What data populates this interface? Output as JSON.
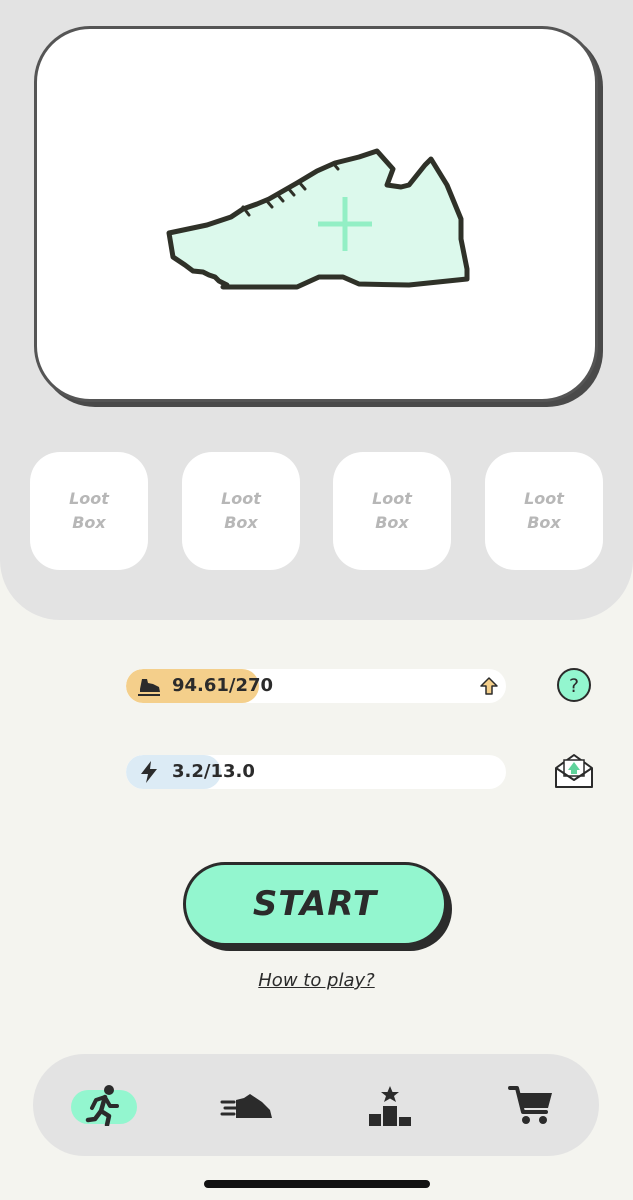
{
  "sneaker_slot": {
    "icon": "plus-icon",
    "shoe_icon": "sneaker-outline-icon"
  },
  "loot_boxes": [
    {
      "line1": "Loot",
      "line2": "Box"
    },
    {
      "line1": "Loot",
      "line2": "Box"
    },
    {
      "line1": "Loot",
      "line2": "Box"
    },
    {
      "line1": "Loot",
      "line2": "Box"
    }
  ],
  "stats": {
    "distance": {
      "text": "94.61/270",
      "icon": "running-shoe-icon",
      "action_icon": "upgrade-arrow-icon",
      "fill_color": "#f4cf8b",
      "progress": 0.35
    },
    "energy": {
      "text": "3.2/13.0",
      "icon": "lightning-icon",
      "fill_color": "#dcebf5",
      "progress": 0.25
    }
  },
  "help_button": {
    "label": "?",
    "color": "#93f6cf"
  },
  "mail_icon": "envelope-icon",
  "start_button": {
    "label": "START",
    "color": "#93f6cf"
  },
  "how_to_play": "How to play?",
  "nav": [
    {
      "id": "run",
      "icon": "running-person-icon",
      "active": true
    },
    {
      "id": "sneakers",
      "icon": "sneaker-icon",
      "active": false
    },
    {
      "id": "leaderboard",
      "icon": "podium-icon",
      "active": false
    },
    {
      "id": "shop",
      "icon": "cart-icon",
      "active": false
    }
  ]
}
